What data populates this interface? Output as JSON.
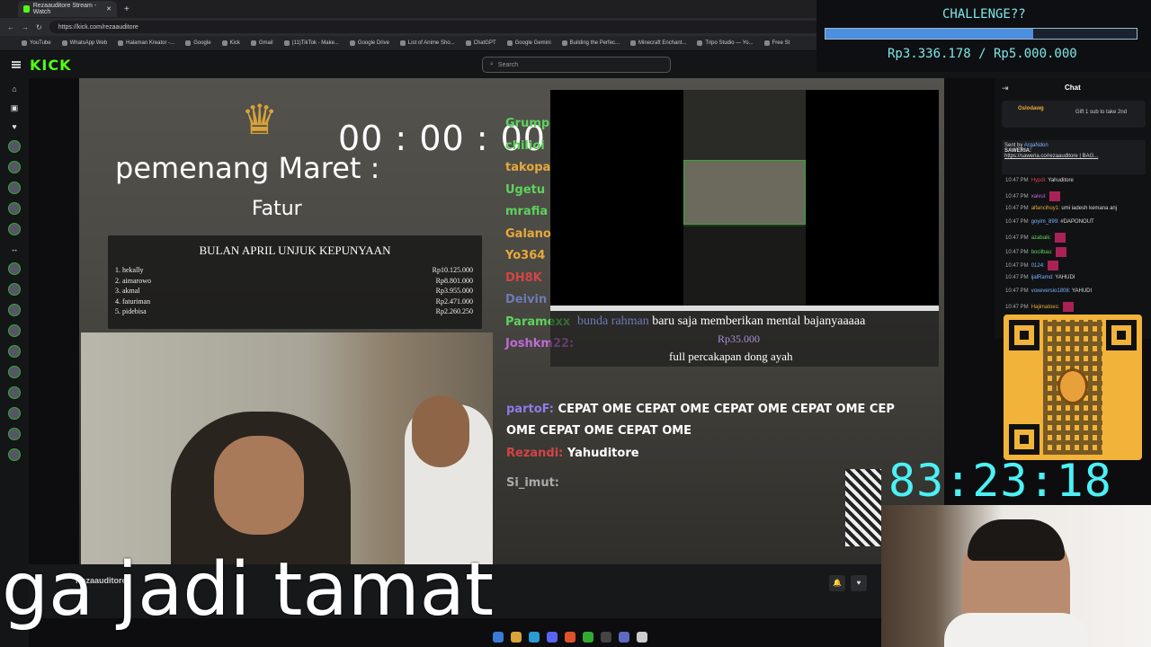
{
  "browser": {
    "tab_title": "Rezaauditore Stream - Watch",
    "url": "https://kick.com/rezaauditore",
    "bookmarks": [
      "YouTube",
      "WhatsApp Web",
      "Halaman Kreator -...",
      "Google",
      "Kick",
      "Gmail",
      "(11)TikTok - Make...",
      "Google Drive",
      "List of Anime Sho...",
      "ChatGPT",
      "Google Gemini",
      "Building the Perfec...",
      "Minecraft Enchant...",
      "Tripo Studio — Yo...",
      "Free St"
    ]
  },
  "kick": {
    "logo": "KICK",
    "search_placeholder": "Search"
  },
  "overlay": {
    "crown": "♛",
    "winner_title": "pemenang Maret  :",
    "winner_name": "Fatur",
    "clock": "00 : 00 : 00",
    "ranking_title": "BULAN APRIL UNJUK KEPUNYAAN",
    "ranking": [
      {
        "name": "1. hekally",
        "amount": "Rp10.125.000"
      },
      {
        "name": "2. aimarowo",
        "amount": "Rp8.801.000"
      },
      {
        "name": "3. akmal",
        "amount": "Rp3.955.000"
      },
      {
        "name": "4. faturiman",
        "amount": "Rp2.471.000"
      },
      {
        "name": "5. pidebisa",
        "amount": "Rp2.260.250"
      }
    ],
    "ov_names": [
      {
        "text": "Grump",
        "color": "#5dd35d"
      },
      {
        "text": "chilioi",
        "color": "#5dd35d"
      },
      {
        "text": "takopa",
        "color": "#e8a93b"
      },
      {
        "text": "Ugetu",
        "color": "#5dd35d"
      },
      {
        "text": "mrafia",
        "color": "#5dd35d"
      },
      {
        "text": "Galano",
        "color": "#e8a93b"
      },
      {
        "text": "Yo364",
        "color": "#e8a93b"
      },
      {
        "text": "DH8K",
        "color": "#d24545"
      },
      {
        "text": "Deivin",
        "color": "#6e7ab5"
      },
      {
        "text": "Paramexx",
        "color": "#5dd35d"
      },
      {
        "text": "Joshkm22:",
        "color": "#c06ad6"
      }
    ],
    "donation": {
      "name": "bunda rahman",
      "text": "baru saja memberikan mental bajanyaaaaa",
      "amount": "Rp35.000",
      "message": "full percakapan dong ayah"
    },
    "chat": [
      {
        "user": "partoF:",
        "user_color": "#8f7be8",
        "msg": "CEPAT OME CEPAT OME CEPAT OME CEPAT OME CEP"
      },
      {
        "user": "",
        "user_color": "#fff",
        "msg": "OME CEPAT OME CEPAT OME"
      },
      {
        "user": "Rezandi:",
        "user_color": "#d24545",
        "msg": "Yahuditore"
      },
      {
        "user": "Si_imut:",
        "user_color": "#aaa",
        "msg": ""
      }
    ]
  },
  "stream_info": {
    "streamer": "Rezaauditore",
    "subtitle_caption": "ga jadi tamat"
  },
  "chat_panel": {
    "title": "Chat",
    "pinned_user": "Oslodawg",
    "pinned_text": "Gift 1 sub to take 2nd",
    "sent_by_label": "Sent by",
    "sent_by_user": "ArgaNdon",
    "saweria_label": "SAWERIA:",
    "saweria_link": "https://saweria.co/rezaauditore | BAG...",
    "messages": [
      {
        "time": "10:47 PM",
        "user": "Hypdi:",
        "user_color": "#d24545",
        "text": "Yahuditore",
        "emote": false
      },
      {
        "time": "10:47 PM",
        "user": "xaivui:",
        "user_color": "#c06ad6",
        "text": "",
        "emote": true
      },
      {
        "time": "10:47 PM",
        "user": "alfancihuy1:",
        "user_color": "#e8a93b",
        "text": "umi iadesh kemana anj",
        "emote": false
      },
      {
        "time": "10:47 PM",
        "user": "goyim_899:",
        "user_color": "#7ab3ff",
        "text": "#DAPONOUT",
        "emote": false
      },
      {
        "time": "10:47 PM",
        "user": "azabaik:",
        "user_color": "#5dd35d",
        "text": "",
        "emote": true
      },
      {
        "time": "10:47 PM",
        "user": "bocilbau:",
        "user_color": "#5dd35d",
        "text": "",
        "emote": true
      },
      {
        "time": "10:47 PM",
        "user": "0124:",
        "user_color": "#7ab3ff",
        "text": "",
        "emote": true
      },
      {
        "time": "10:47 PM",
        "user": "ijalRamd:",
        "user_color": "#7ab3ff",
        "text": "YAHUDI",
        "emote": false
      },
      {
        "time": "10:47 PM",
        "user": "voxeversio1808:",
        "user_color": "#7ab3ff",
        "text": "YAHUDI",
        "emote": false
      },
      {
        "time": "10:47 PM",
        "user": "Hajimatoes:",
        "user_color": "#e8a93b",
        "text": "",
        "emote": true
      }
    ]
  },
  "challenge": {
    "title": "CHALLENGE??",
    "progress_fraction": 0.667,
    "amount": "Rp3.336.178 / Rp5.000.000"
  },
  "timer": "83:23:18",
  "colors": {
    "kick_green": "#53fc18",
    "timer_cyan": "#4bf1f5",
    "challenge_text": "#7fe6e6",
    "challenge_bar": "#4c8ee0",
    "qr_gold": "#f2b33a"
  }
}
